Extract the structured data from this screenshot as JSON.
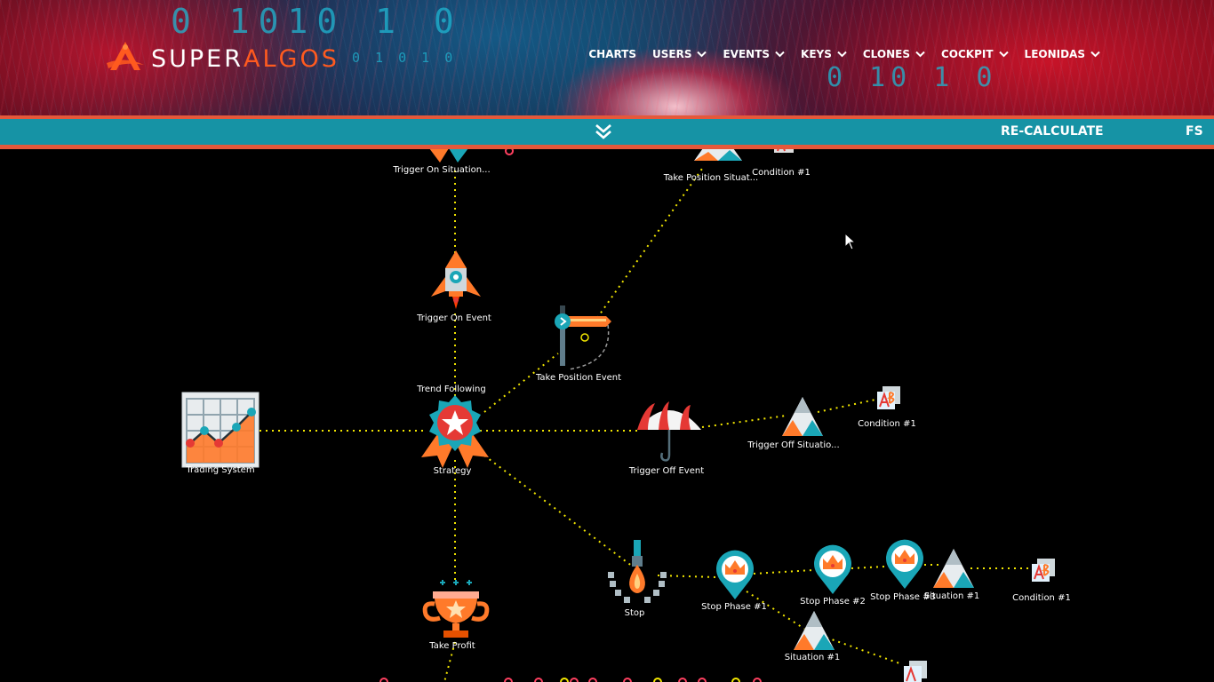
{
  "header": {
    "brand_part1": "SUPER",
    "brand_part2": "ALGOS",
    "binary_top": "0 1010 1 0",
    "binary_mid": "0 1 0 1 0",
    "binary_right": "0 10 1 0",
    "nav": [
      {
        "label": "CHARTS",
        "has_dropdown": false
      },
      {
        "label": "USERS",
        "has_dropdown": true
      },
      {
        "label": "EVENTS",
        "has_dropdown": true
      },
      {
        "label": "KEYS",
        "has_dropdown": true
      },
      {
        "label": "CLONES",
        "has_dropdown": true
      },
      {
        "label": "COCKPIT",
        "has_dropdown": true
      },
      {
        "label": "LEONIDAS",
        "has_dropdown": true
      }
    ]
  },
  "toolbar": {
    "recalculate_label": "RE-CALCULATE",
    "fullscreen_label": "FS"
  },
  "canvas": {
    "nodes": {
      "trigger_on_situation": "Trigger On Situation...",
      "take_position_situation": "Take Position Situat...",
      "condition_top": "Condition #1",
      "trigger_on_event": "Trigger On Event",
      "take_position_event": "Take Position Event",
      "trading_system": "Trading System",
      "strategy_name": "Trend Following",
      "strategy": "Strategy",
      "trigger_off_event": "Trigger Off Event",
      "trigger_off_situation": "Trigger Off Situatio...",
      "condition_right": "Condition #1",
      "stop": "Stop",
      "stop_phase_1": "Stop Phase #1",
      "stop_phase_2": "Stop Phase #2",
      "stop_phase_3": "Stop Phase #3",
      "situation_right": "Situation #1",
      "condition_bottom_right": "Condition #1",
      "situation_bottom": "Situation #1",
      "take_profit": "Take Profit"
    }
  },
  "colors": {
    "toolbar": "#1693a5",
    "accent_orange": "#e5583a",
    "link": "#f2e600",
    "brand_orange": "#ff5a1f"
  }
}
